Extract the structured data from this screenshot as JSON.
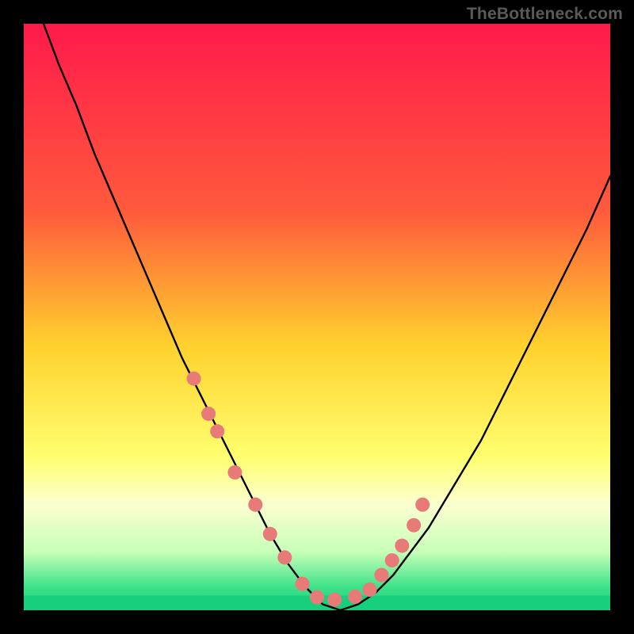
{
  "watermark": "TheBottleneck.com",
  "chart_data": {
    "type": "line",
    "title": "",
    "xlabel": "",
    "ylabel": "",
    "xlim": [
      0,
      100
    ],
    "ylim": [
      0,
      100
    ],
    "gradient_stops": [
      {
        "offset": 0,
        "color": "#ff1a4b"
      },
      {
        "offset": 32,
        "color": "#ff5a3c"
      },
      {
        "offset": 55,
        "color": "#ffd22e"
      },
      {
        "offset": 74,
        "color": "#ffff70"
      },
      {
        "offset": 82,
        "color": "#fbffd0"
      },
      {
        "offset": 90,
        "color": "#c8ffb9"
      },
      {
        "offset": 96,
        "color": "#3fe28a"
      },
      {
        "offset": 100,
        "color": "#17d07d"
      }
    ],
    "series": [
      {
        "name": "curve",
        "type": "line",
        "x": [
          0,
          3,
          6,
          9,
          12,
          15,
          18,
          21,
          24,
          27,
          30,
          33,
          36,
          39,
          42,
          45,
          48,
          51,
          54,
          57,
          60,
          63,
          66,
          69,
          72,
          75,
          78,
          81,
          84,
          87,
          90,
          93,
          96,
          100
        ],
        "values": [
          108,
          101,
          93,
          86,
          78,
          71,
          64,
          57,
          50,
          43,
          37,
          31,
          25,
          19,
          13,
          8,
          4,
          1,
          0,
          1,
          3,
          6,
          10,
          14,
          19,
          24,
          29,
          35,
          41,
          47,
          53,
          59,
          65,
          74
        ]
      },
      {
        "name": "markers",
        "type": "scatter",
        "color": "#e87b78",
        "x": [
          29.0,
          31.5,
          33.0,
          36.0,
          39.5,
          42.0,
          44.5,
          47.5,
          50.0,
          53.0,
          56.5,
          59.0,
          61.0,
          62.8,
          64.5,
          66.5,
          68.0
        ],
        "values": [
          39.5,
          33.5,
          30.5,
          23.5,
          18.0,
          13.0,
          9.0,
          4.5,
          2.2,
          1.8,
          2.3,
          3.5,
          6.0,
          8.5,
          11.0,
          14.5,
          18.0
        ]
      }
    ],
    "bottom_band": {
      "y_from": 0,
      "y_to": 2.5,
      "color": "#17d07d"
    }
  }
}
